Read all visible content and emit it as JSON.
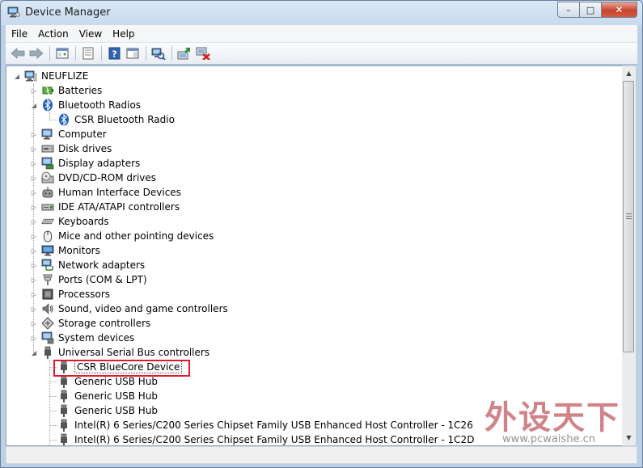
{
  "window": {
    "title": "Device Manager",
    "icon": "device-manager-icon",
    "buttons": {
      "minimize": "–",
      "maximize": "□",
      "close": "✕"
    }
  },
  "menu": [
    {
      "label": "File",
      "key": "F"
    },
    {
      "label": "Action",
      "key": "A"
    },
    {
      "label": "View",
      "key": "V"
    },
    {
      "label": "Help",
      "key": "H"
    }
  ],
  "toolbar": [
    "back-icon",
    "forward-icon",
    "show-hide-console-tree-icon",
    "properties-icon",
    "help-icon",
    "action-pane-icon",
    "scan-hardware-changes-icon",
    "update-driver-icon",
    "uninstall-icon"
  ],
  "tree": {
    "root": "NEUFLIZE",
    "items": [
      {
        "label": "Batteries",
        "icon": "battery-icon"
      },
      {
        "label": "Bluetooth Radios",
        "icon": "bluetooth-icon",
        "expanded": true
      },
      {
        "label": "CSR Bluetooth Radio",
        "icon": "bluetooth-icon"
      },
      {
        "label": "Computer",
        "icon": "computer-icon"
      },
      {
        "label": "Disk drives",
        "icon": "disk-drive-icon"
      },
      {
        "label": "Display adapters",
        "icon": "display-adapter-icon"
      },
      {
        "label": "DVD/CD-ROM drives",
        "icon": "dvd-drive-icon"
      },
      {
        "label": "Human Interface Devices",
        "icon": "hid-icon"
      },
      {
        "label": "IDE ATA/ATAPI controllers",
        "icon": "ide-controller-icon"
      },
      {
        "label": "Keyboards",
        "icon": "keyboard-icon"
      },
      {
        "label": "Mice and other pointing devices",
        "icon": "mouse-icon"
      },
      {
        "label": "Monitors",
        "icon": "monitor-icon"
      },
      {
        "label": "Network adapters",
        "icon": "network-adapter-icon"
      },
      {
        "label": "Ports (COM & LPT)",
        "icon": "port-icon"
      },
      {
        "label": "Processors",
        "icon": "processor-icon"
      },
      {
        "label": "Sound, video and game controllers",
        "icon": "sound-icon"
      },
      {
        "label": "Storage controllers",
        "icon": "storage-controller-icon"
      },
      {
        "label": "System devices",
        "icon": "system-device-icon"
      },
      {
        "label": "Universal Serial Bus controllers",
        "icon": "usb-icon",
        "expanded": true
      },
      {
        "label": "CSR BlueCore Device",
        "icon": "usb-plug-icon",
        "selected": true
      },
      {
        "label": "Generic USB Hub",
        "icon": "usb-plug-icon"
      },
      {
        "label": "Generic USB Hub",
        "icon": "usb-plug-icon"
      },
      {
        "label": "Generic USB Hub",
        "icon": "usb-plug-icon"
      },
      {
        "label": "Intel(R) 6 Series/C200 Series Chipset Family USB Enhanced Host Controller - 1C26",
        "icon": "usb-plug-icon"
      },
      {
        "label": "Intel(R) 6 Series/C200 Series Chipset Family USB Enhanced Host Controller - 1C2D",
        "icon": "usb-plug-icon"
      }
    ]
  },
  "watermark": {
    "main": "外设天下",
    "url": "www.pcwaishe.cn"
  },
  "colors": {
    "highlight": "#e0192c",
    "titlebar": "#c8daee"
  }
}
